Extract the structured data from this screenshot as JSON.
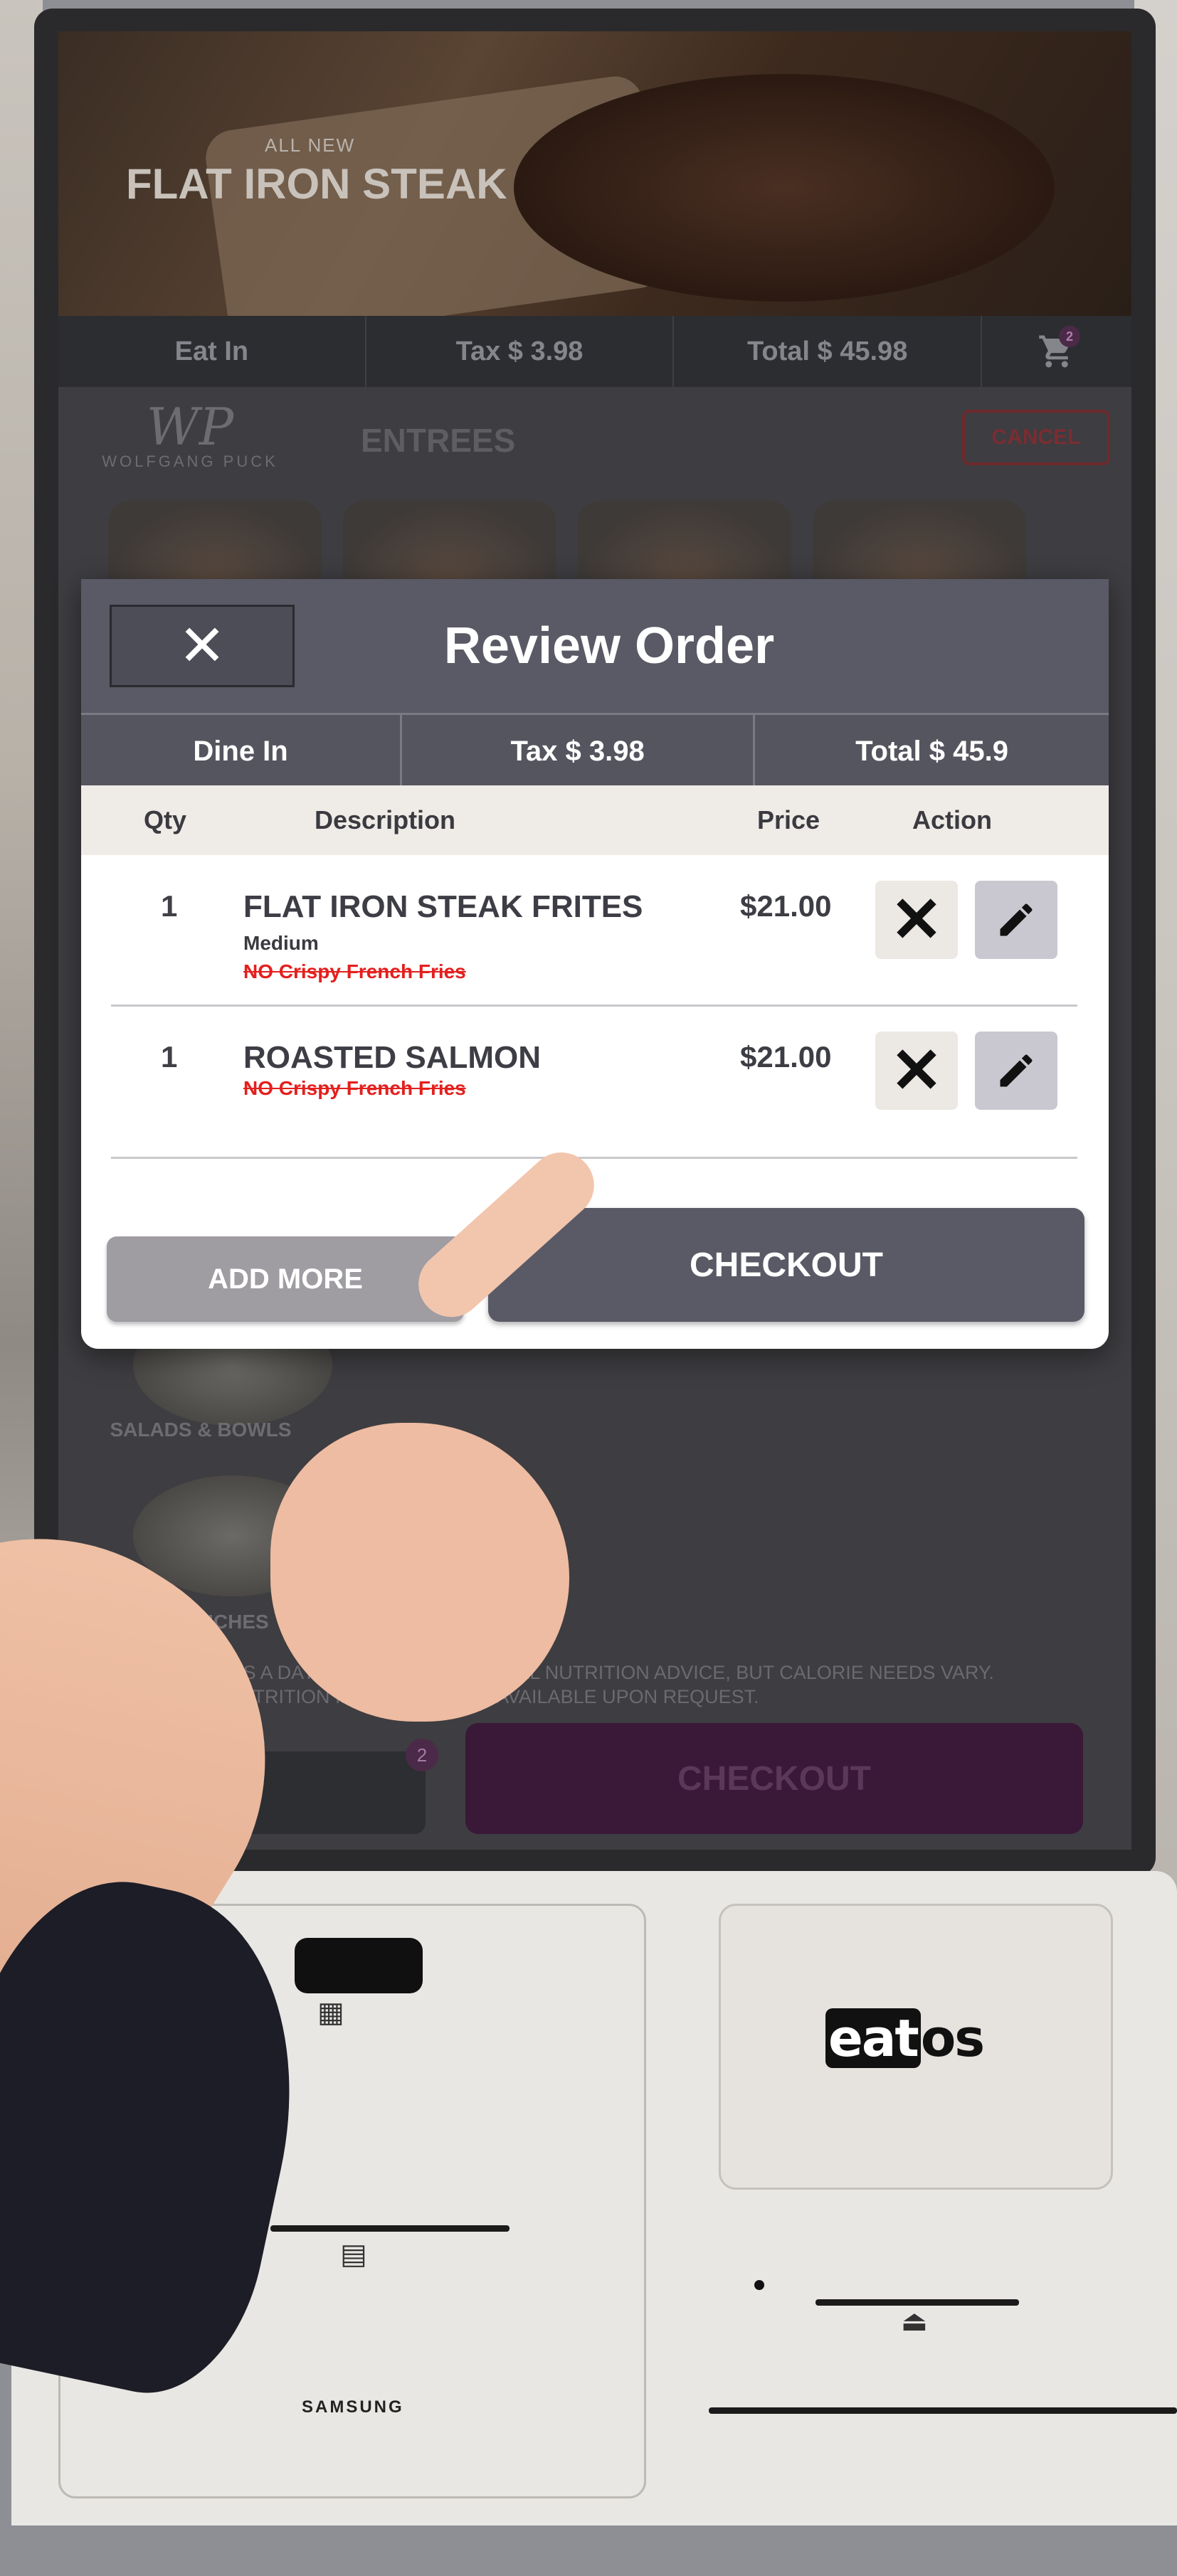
{
  "kiosk": {
    "hero": {
      "eyebrow": "ALL NEW",
      "title": "FLAT IRON STEAK"
    },
    "summary": {
      "mode": "Eat In",
      "tax": "Tax  $ 3.98",
      "total": "Total  $ 45.98",
      "cart_count": "2"
    },
    "brand": {
      "logo_mark": "WP",
      "logo_name": "WOLFGANG  PUCK"
    },
    "category_title": "ENTREES",
    "cancel_label": "CANCEL",
    "side_categories": [
      "SALADS & BOWLS",
      "SANDWICHES"
    ],
    "disclaimer": "2,000 CALORIES A DAY IS USED FOR GENERAL NUTRITION ADVICE, BUT CALORIE NEEDS VARY. ADDITIONAL NUTRITION INFORMATION IS AVAILABLE UPON REQUEST.",
    "bottom_cart_count": "2",
    "bottom_checkout_label": "CHECKOUT"
  },
  "modal": {
    "title": "Review Order",
    "close_icon": "close-icon",
    "info": {
      "mode": "Dine In",
      "tax": "Tax  $ 3.98",
      "total": "Total  $ 45.9"
    },
    "columns": {
      "qty": "Qty",
      "description": "Description",
      "price": "Price",
      "action": "Action"
    },
    "items": [
      {
        "qty": "1",
        "name": "FLAT IRON STEAK FRITES",
        "modifier": "Medium",
        "removed": "NO Crispy French Fries",
        "price": "$21.00"
      },
      {
        "qty": "1",
        "name": "ROASTED SALMON",
        "modifier": "",
        "removed": "NO Crispy French Fries",
        "price": "$21.00"
      }
    ],
    "add_more_label": "ADD MORE",
    "checkout_label": "CHECKOUT"
  },
  "hardware": {
    "brand": "eatos",
    "maker": "SAMSUNG"
  },
  "colors": {
    "header": "#5a5a66",
    "removed_text": "#e3201e",
    "checkout": "#5a5a66",
    "add_more": "#9f9ca2"
  }
}
